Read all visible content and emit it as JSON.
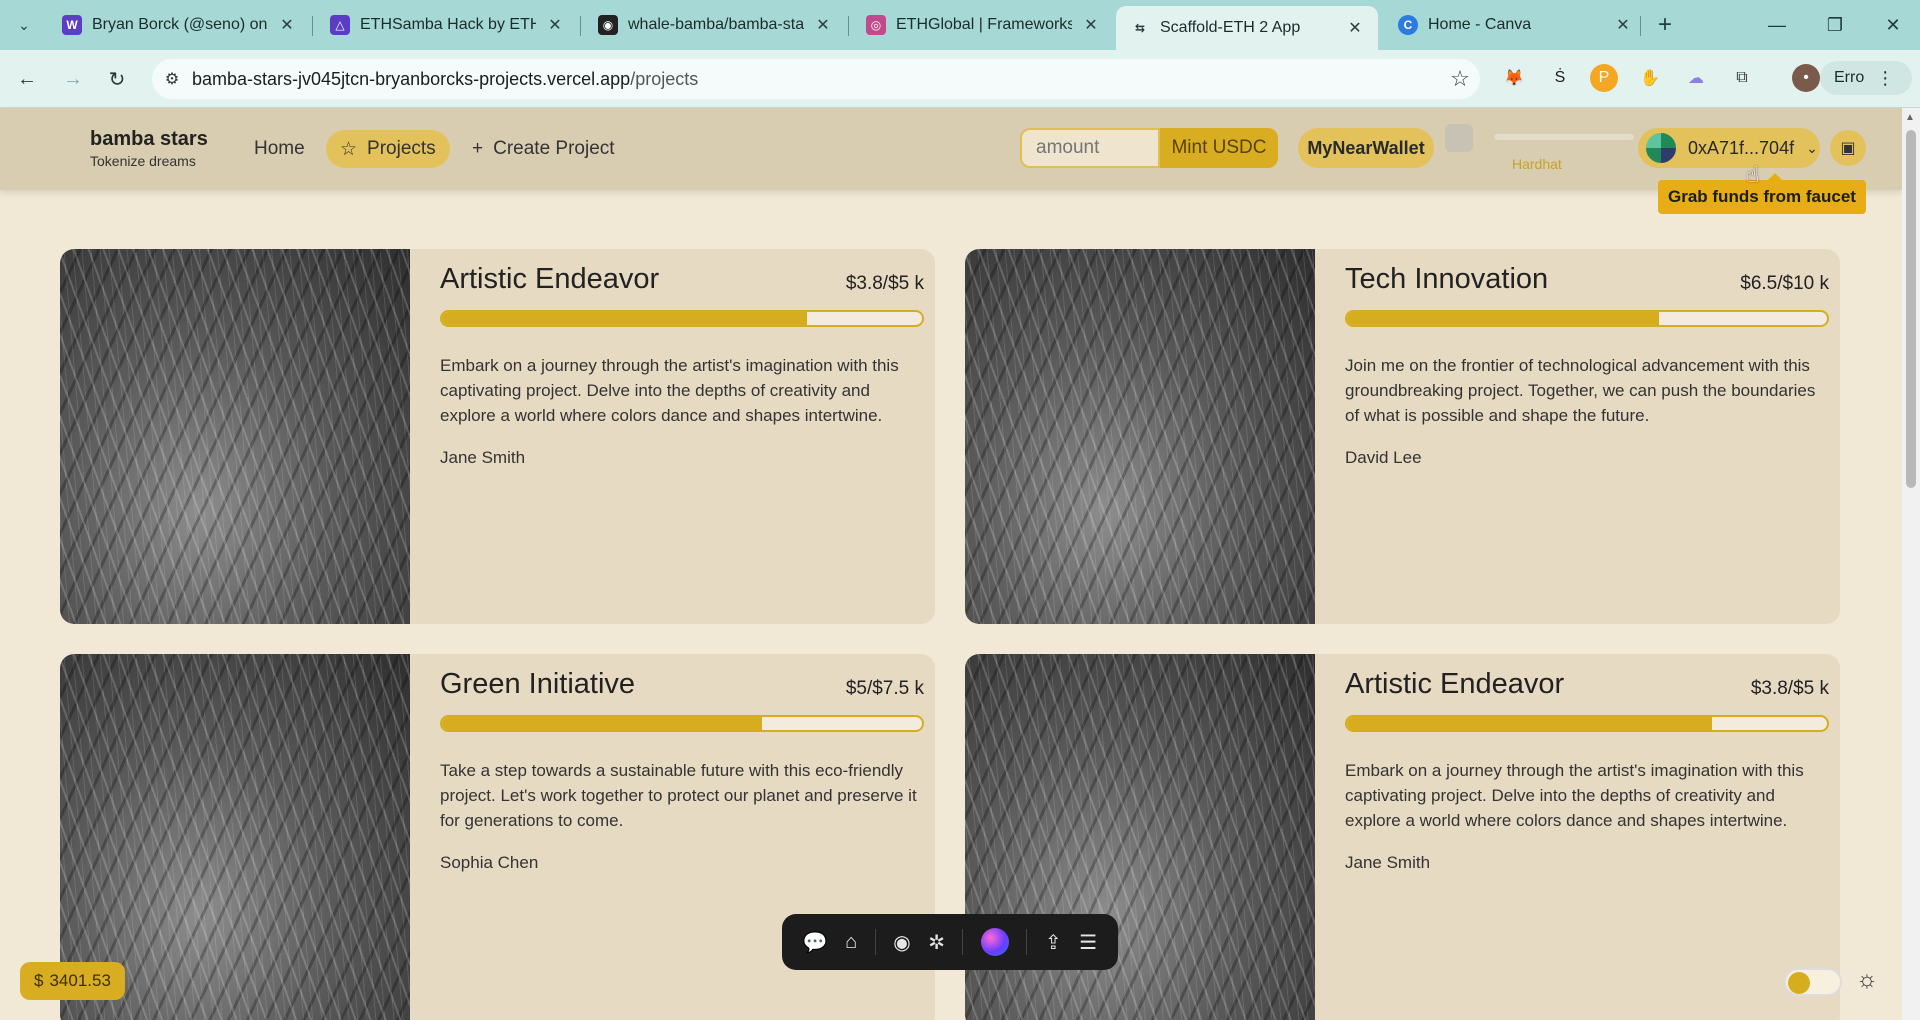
{
  "browser": {
    "tabs": [
      {
        "title": "Bryan Borck (@seno) on Fa",
        "favicon": "W",
        "favicon_color": "#5a3fc0",
        "active": false
      },
      {
        "title": "ETHSamba Hack by ETHSa",
        "favicon": "△",
        "favicon_color": "#5b3cc4",
        "active": false
      },
      {
        "title": "whale-bamba/bamba-stars",
        "favicon": "◉",
        "favicon_color": "#222222",
        "active": false
      },
      {
        "title": "ETHGlobal | Frameworks",
        "favicon": "◎",
        "favicon_color": "#c24a8a",
        "active": false
      },
      {
        "title": "Scaffold-ETH 2 App",
        "favicon": "⇆",
        "favicon_color": "#2a3a3a",
        "active": true
      },
      {
        "title": "Home - Canva",
        "favicon": "C",
        "favicon_color": "#2d7be0",
        "active": false
      }
    ],
    "url_host": "bamba-stars-jv045jtcn-bryanborcks-projects.vercel.app",
    "url_path": "/projects",
    "profile_label": "Erro"
  },
  "app": {
    "brand_name": "bamba stars",
    "brand_tagline": "Tokenize dreams",
    "nav": {
      "home": "Home",
      "projects": "Projects",
      "create": "Create Project"
    },
    "amount_placeholder": "amount",
    "mint_label": "Mint USDC",
    "wallet_label": "MyNearWallet",
    "network_label": "Hardhat",
    "address": "0xA71f...704f",
    "tooltip": "Grab funds from faucet",
    "balance": "3401.53"
  },
  "projects": [
    {
      "title": "Artistic Endeavor",
      "funds": "$3.8/$5 k",
      "raised": 3.8,
      "goal": 5,
      "description": "Embark on a journey through the artist's imagination with this captivating project. Delve into the depths of creativity and explore a world where colors dance and shapes intertwine.",
      "author": "Jane Smith"
    },
    {
      "title": "Tech Innovation",
      "funds": "$6.5/$10 k",
      "raised": 6.5,
      "goal": 10,
      "description": "Join me on the frontier of technological advancement with this groundbreaking project. Together, we can push the boundaries of what is possible and shape the future.",
      "author": "David Lee"
    },
    {
      "title": "Green Initiative",
      "funds": "$5/$7.5 k",
      "raised": 5,
      "goal": 7.5,
      "description": "Take a step towards a sustainable future with this eco-friendly project. Let's work together to protect our planet and preserve it for generations to come.",
      "author": "Sophia Chen"
    },
    {
      "title": "Artistic Endeavor",
      "funds": "$3.8/$5 k",
      "raised": 3.8,
      "goal": 5,
      "description": "Embark on a journey through the artist's imagination with this captivating project. Delve into the depths of creativity and explore a world where colors dance and shapes intertwine.",
      "author": "Jane Smith"
    }
  ],
  "colors": {
    "accent": "#d7ad20",
    "header_bg": "#d9cdb1",
    "page_bg": "#f1e8d6",
    "card_bg": "#e6dac3"
  }
}
